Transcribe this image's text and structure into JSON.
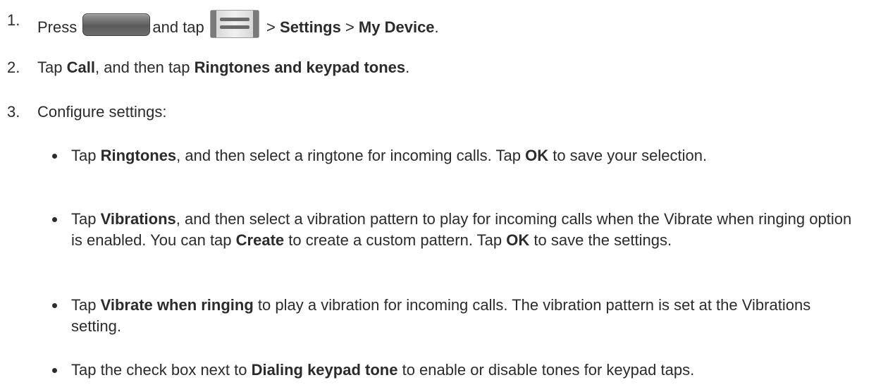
{
  "steps": [
    {
      "num": "1.",
      "parts": {
        "press": "Press",
        "and_tap": "and tap",
        "sep1": ">",
        "settings": "Settings",
        "sep2": ">",
        "my_device": "My Device",
        "end": "."
      }
    },
    {
      "num": "2.",
      "parts": {
        "tap": "Tap",
        "call": "Call",
        "and_then_tap": ", and then tap",
        "ringtones_keypad": "Ringtones and keypad tones",
        "end": "."
      }
    },
    {
      "num": "3.",
      "text": "Configure settings:"
    }
  ],
  "bullets": [
    {
      "tap": "Tap",
      "bold1": "Ringtones",
      "mid1": ", and then select a ringtone for incoming calls. Tap",
      "bold2": "OK",
      "tail": "to save your selection."
    },
    {
      "tap": "Tap",
      "bold1": "Vibrations",
      "mid1": ", and then select a vibration pattern to play for incoming calls when the Vibrate when ringing option is enabled. You can tap",
      "bold2": "Create",
      "mid2": "to create a custom pattern. Tap",
      "bold3": "OK",
      "tail": "to save the settings."
    },
    {
      "tap": "Tap",
      "bold1": "Vibrate when ringing",
      "tail": "to play a vibration for incoming calls. The vibration pattern is set at the Vibrations setting."
    },
    {
      "tap": "Tap the check box next to",
      "bold1": "Dialing keypad tone",
      "tail": "to enable or disable tones for keypad taps."
    }
  ],
  "icons": {
    "home_button": "home-button-icon",
    "menu_button": "menu-button-icon"
  }
}
